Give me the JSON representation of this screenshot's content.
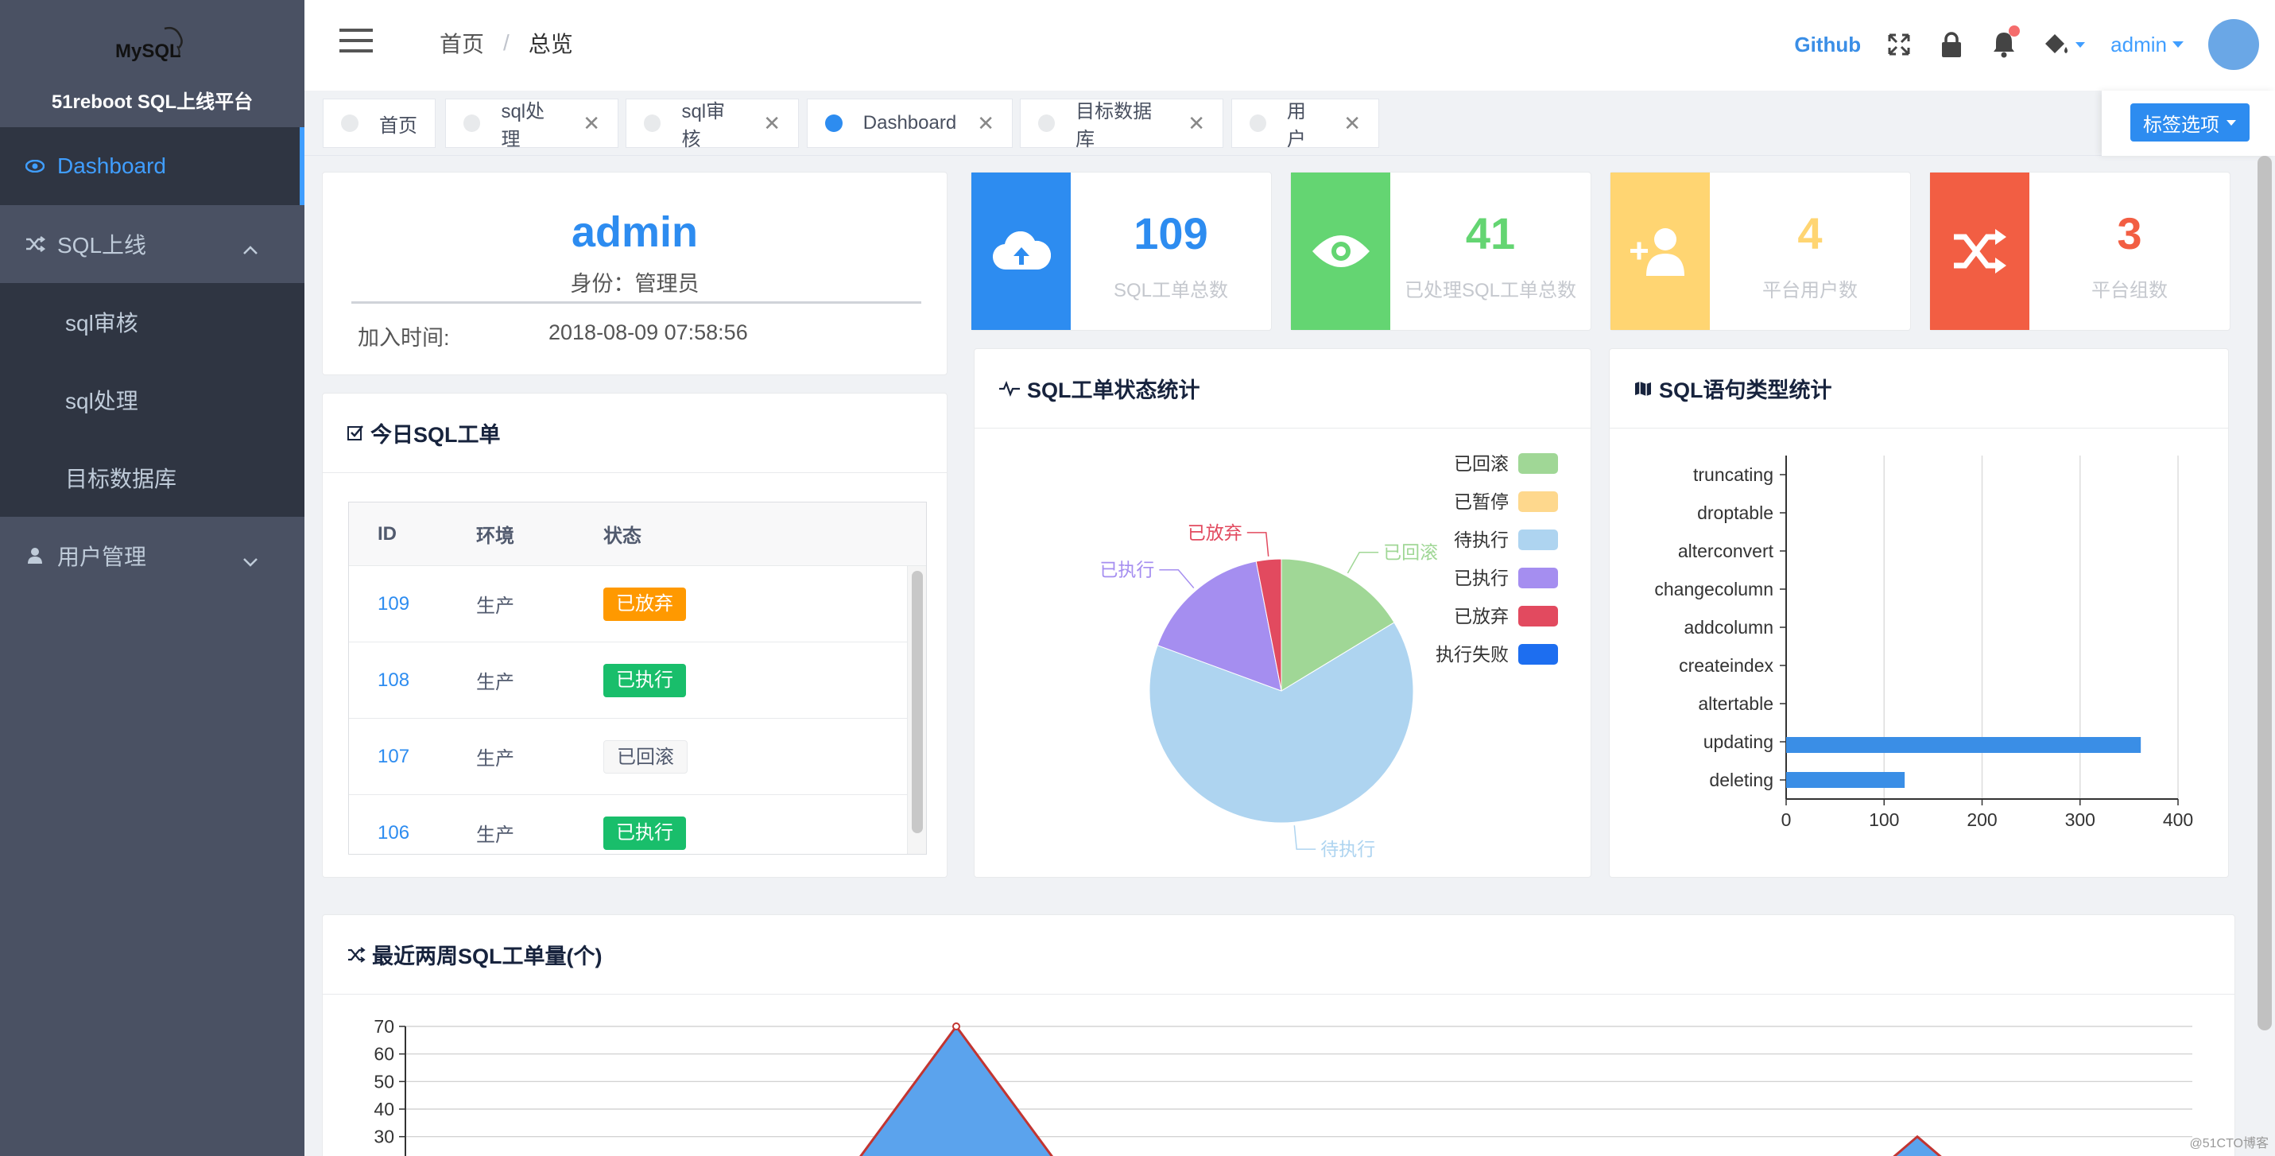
{
  "app": {
    "title": "51reboot SQL上线平台",
    "logo_text": "MySQL"
  },
  "sidebar": {
    "items": [
      {
        "label": "Dashboard",
        "icon": "eye-icon",
        "active": true
      },
      {
        "label": "SQL上线",
        "icon": "shuffle-icon",
        "expanded": true,
        "children": [
          {
            "label": "sql审核"
          },
          {
            "label": "sql处理"
          },
          {
            "label": "目标数据库"
          }
        ]
      },
      {
        "label": "用户管理",
        "icon": "user-icon",
        "expanded": false
      }
    ]
  },
  "header": {
    "breadcrumb": {
      "home": "首页",
      "separator": "/",
      "current": "总览"
    },
    "github": "Github",
    "user": "admin"
  },
  "tabs": {
    "items": [
      {
        "label": "首页",
        "closable": false,
        "active": false
      },
      {
        "label": "sql处理",
        "closable": true,
        "active": false
      },
      {
        "label": "sql审核",
        "closable": true,
        "active": false
      },
      {
        "label": "Dashboard",
        "closable": true,
        "active": true
      },
      {
        "label": "目标数据库",
        "closable": true,
        "active": false
      },
      {
        "label": "用户",
        "closable": true,
        "active": false
      }
    ],
    "options_label": "标签选项"
  },
  "user_card": {
    "name": "admin",
    "role": "身份：管理员",
    "join_label": "加入时间:",
    "join_value": "2018-08-09 07:58:56"
  },
  "stats": [
    {
      "value": "109",
      "label": "SQL工单总数",
      "color": "#2d8cf0",
      "icon": "cloud-upload-icon"
    },
    {
      "value": "41",
      "label": "已处理SQL工单总数",
      "color": "#64d572",
      "icon": "eye-icon"
    },
    {
      "value": "4",
      "label": "平台用户数",
      "color": "#ffd572",
      "icon": "user-add-icon"
    },
    {
      "value": "3",
      "label": "平台组数",
      "color": "#f25e43",
      "icon": "shuffle-icon"
    }
  ],
  "today_orders": {
    "title": "今日SQL工单",
    "columns": [
      "ID",
      "环境",
      "状态"
    ],
    "rows": [
      {
        "id": "109",
        "env": "生产",
        "status": "已放弃",
        "status_type": "orange"
      },
      {
        "id": "108",
        "env": "生产",
        "status": "已执行",
        "status_type": "green"
      },
      {
        "id": "107",
        "env": "生产",
        "status": "已回滚",
        "status_type": "default"
      },
      {
        "id": "106",
        "env": "生产",
        "status": "已执行",
        "status_type": "green"
      }
    ]
  },
  "pie_card": {
    "title": "SQL工单状态统计"
  },
  "bar_card": {
    "title": "SQL语句类型统计"
  },
  "line_card": {
    "title": "最近两周SQL工单量(个)"
  },
  "chart_data": [
    {
      "type": "pie",
      "legend_position": "top-right",
      "slices": [
        {
          "name": "已回滚",
          "value": 16,
          "color": "#a0d796"
        },
        {
          "name": "已暂停",
          "value": 0,
          "color": "#fed88d"
        },
        {
          "name": "待执行",
          "value": 63,
          "color": "#aed4f0"
        },
        {
          "name": "已执行",
          "value": 16,
          "color": "#a58ef0"
        },
        {
          "name": "已放弃",
          "value": 3,
          "color": "#e24a5f"
        },
        {
          "name": "执行失败",
          "value": 0,
          "color": "#1d6ef0"
        }
      ]
    },
    {
      "type": "bar",
      "orientation": "horizontal",
      "categories": [
        "truncating",
        "droptable",
        "alterconvert",
        "changecolumn",
        "addcolumn",
        "createindex",
        "altertable",
        "updating",
        "deleting"
      ],
      "values": [
        0,
        0,
        0,
        0,
        0,
        0,
        0,
        362,
        121
      ],
      "xlim": [
        0,
        400
      ],
      "xticks": [
        0,
        100,
        200,
        300,
        400
      ],
      "color": "#3a8ee6",
      "grid": true
    },
    {
      "type": "area",
      "yticks_visible": [
        70,
        60,
        50,
        40,
        30
      ],
      "ylim": [
        0,
        70
      ],
      "peak_value": 70,
      "secondary_peak_value": 30,
      "fill_color": "#5ba3ed",
      "line_color": "#c23531"
    }
  ],
  "watermark": "@51CTO博客"
}
